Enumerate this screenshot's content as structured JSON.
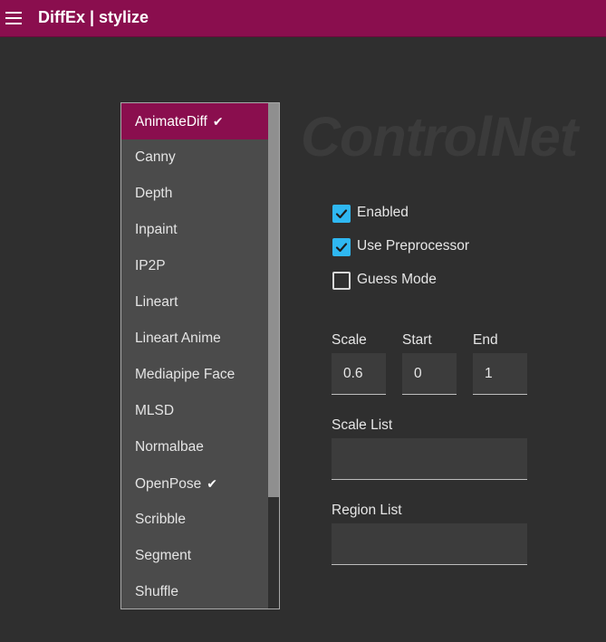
{
  "app": {
    "title": "DiffEx | stylize",
    "menu_icon": "hamburger-menu-icon",
    "accent_color": "#8a0e4e"
  },
  "watermark": "ControlNet",
  "dropdown": {
    "items": [
      {
        "label": "AnimateDiff",
        "checked": true,
        "active": true
      },
      {
        "label": "Canny",
        "checked": false,
        "active": false
      },
      {
        "label": "Depth",
        "checked": false,
        "active": false
      },
      {
        "label": "Inpaint",
        "checked": false,
        "active": false
      },
      {
        "label": "IP2P",
        "checked": false,
        "active": false
      },
      {
        "label": "Lineart",
        "checked": false,
        "active": false
      },
      {
        "label": "Lineart Anime",
        "checked": false,
        "active": false
      },
      {
        "label": "Mediapipe Face",
        "checked": false,
        "active": false
      },
      {
        "label": "MLSD",
        "checked": false,
        "active": false
      },
      {
        "label": "Normalbae",
        "checked": false,
        "active": false
      },
      {
        "label": "OpenPose",
        "checked": true,
        "active": false
      },
      {
        "label": "Scribble",
        "checked": false,
        "active": false
      },
      {
        "label": "Segment",
        "checked": false,
        "active": false
      },
      {
        "label": "Shuffle",
        "checked": false,
        "active": false
      }
    ],
    "check_glyph": "✔"
  },
  "options": {
    "enabled": {
      "label": "Enabled",
      "checked": true
    },
    "use_preprocessor": {
      "label": "Use Preprocessor",
      "checked": true
    },
    "guess_mode": {
      "label": "Guess Mode",
      "checked": false
    }
  },
  "params": {
    "scale": {
      "label": "Scale",
      "value": "0.6"
    },
    "start": {
      "label": "Start",
      "value": "0"
    },
    "end": {
      "label": "End",
      "value": "1"
    },
    "scale_list": {
      "label": "Scale List",
      "value": ""
    },
    "region_list": {
      "label": "Region List",
      "value": ""
    }
  },
  "colors": {
    "checkbox_on": "#2fb8f2",
    "background": "#2f2f2f"
  }
}
